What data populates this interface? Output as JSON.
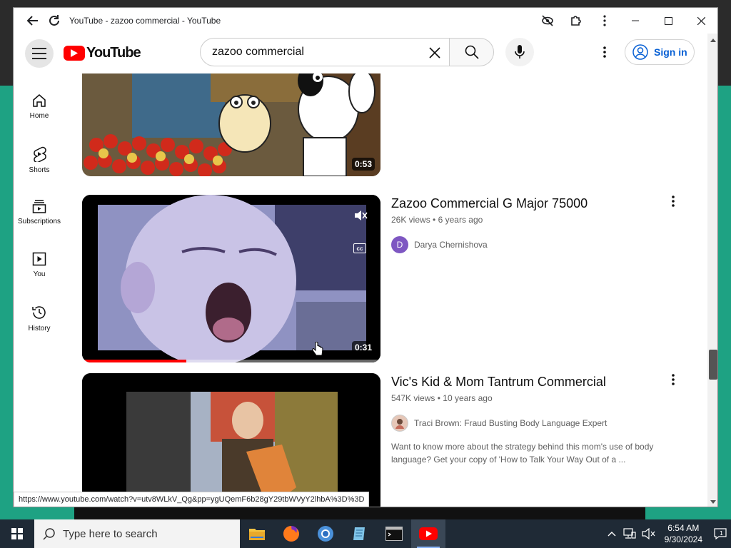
{
  "browser": {
    "tab_title": "YouTube - zazoo commercial - YouTube",
    "status_url": "https://www.youtube.com/watch?v=utv8WLkV_Qg&pp=ygUQemF6b28gY29tbWVyY2lhbA%3D%3D"
  },
  "header": {
    "logo_text": "YouTube",
    "search_query": "zazoo commercial",
    "signin_label": "Sign in"
  },
  "sidebar": {
    "items": [
      {
        "label": "Home",
        "icon": "home-icon"
      },
      {
        "label": "Shorts",
        "icon": "shorts-icon"
      },
      {
        "label": "Subscriptions",
        "icon": "subscriptions-icon"
      },
      {
        "label": "You",
        "icon": "you-icon"
      },
      {
        "label": "History",
        "icon": "history-icon"
      }
    ]
  },
  "videos": [
    {
      "duration": "0:53"
    },
    {
      "title": "Zazoo Commercial G Major 75000",
      "views": "26K views",
      "age": "6 years ago",
      "channel": "Darya Chernishova",
      "avatar_letter": "D",
      "duration": "0:31",
      "progress": 0.35
    },
    {
      "title": "Vic's Kid & Mom Tantrum Commercial",
      "views": "547K views",
      "age": "10 years ago",
      "channel": "Traci Brown: Fraud Busting Body Language Expert",
      "description": "Want to know more about the strategy behind this mom's use of body language? Get your copy of 'How to Talk Your Way Out of a ..."
    }
  ],
  "taskbar": {
    "search_placeholder": "Type here to search",
    "time": "6:54 AM",
    "date": "9/30/2024"
  },
  "colors": {
    "youtube_red": "#ff0000",
    "link_blue": "#065fd4",
    "desktop_teal": "#1ea283"
  }
}
